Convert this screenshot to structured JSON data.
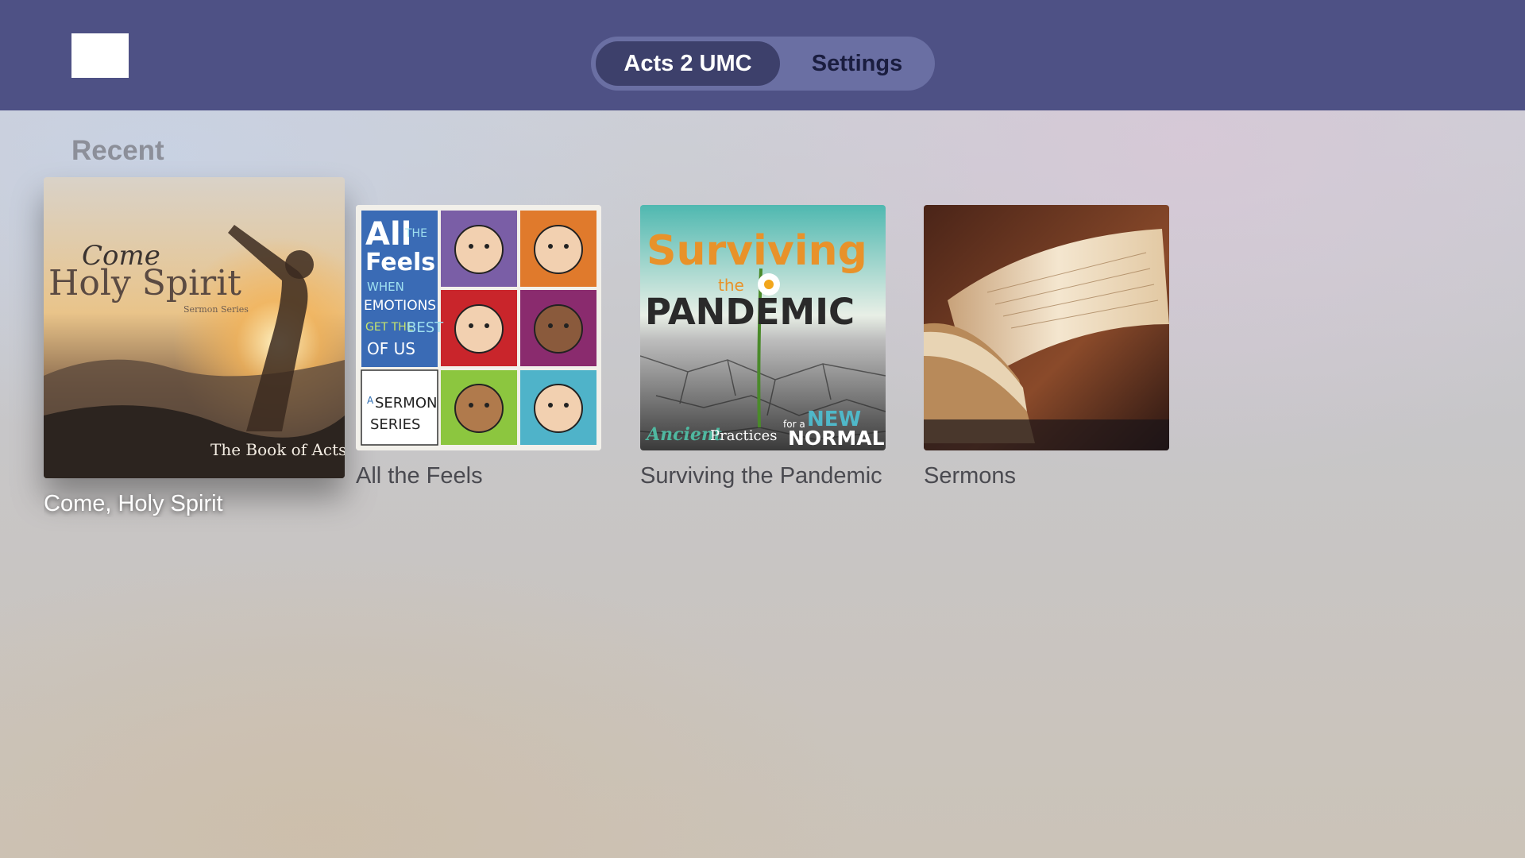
{
  "header": {
    "tabs": [
      {
        "label": "Acts 2 UMC",
        "selected": true
      },
      {
        "label": "Settings",
        "selected": false
      }
    ]
  },
  "recent": {
    "title": "Recent",
    "items": [
      {
        "label": "Come, Holy Spirit",
        "focused": true,
        "art": {
          "line1": "Come",
          "line2": "Holy Spirit",
          "line3": "Sermon Series",
          "line4": "The Book of Acts"
        }
      },
      {
        "label": "All the Feels",
        "focused": false,
        "art": {
          "big1": "All",
          "small1": "THE",
          "big2": "Feels",
          "t1": "WHEN",
          "t2": "EMOTIONS",
          "t3": "GET THE",
          "t4": "BEST",
          "t5": "OF US",
          "s1": "A",
          "s2": "SERMON",
          "s3": "SERIES"
        }
      },
      {
        "label": "Surviving the Pandemic",
        "focused": false,
        "art": {
          "line1": "Surviving",
          "line2": "the",
          "line3": "PANDEMIC",
          "line4": "Ancient",
          "line5": "Practices",
          "line6": "for a",
          "line7": "NEW",
          "line8": "NORMAL"
        }
      },
      {
        "label": "Sermons",
        "focused": false
      }
    ]
  }
}
